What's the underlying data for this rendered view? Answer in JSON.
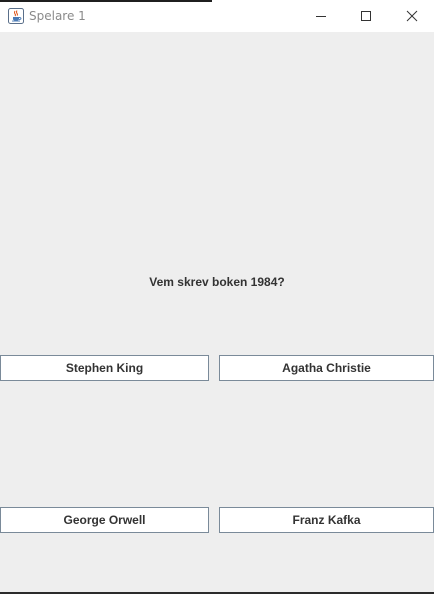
{
  "window": {
    "title": "Spelare 1",
    "controls": {
      "minimize_icon": "minimize-icon",
      "maximize_icon": "maximize-icon",
      "close_icon": "close-icon"
    }
  },
  "quiz": {
    "question": "Vem skrev boken 1984?",
    "answers": [
      "Stephen King",
      "Agatha Christie",
      "George Orwell",
      "Franz Kafka"
    ]
  },
  "colors": {
    "background": "#eeeeee",
    "button_border": "#7a8a99",
    "text": "#333333"
  }
}
